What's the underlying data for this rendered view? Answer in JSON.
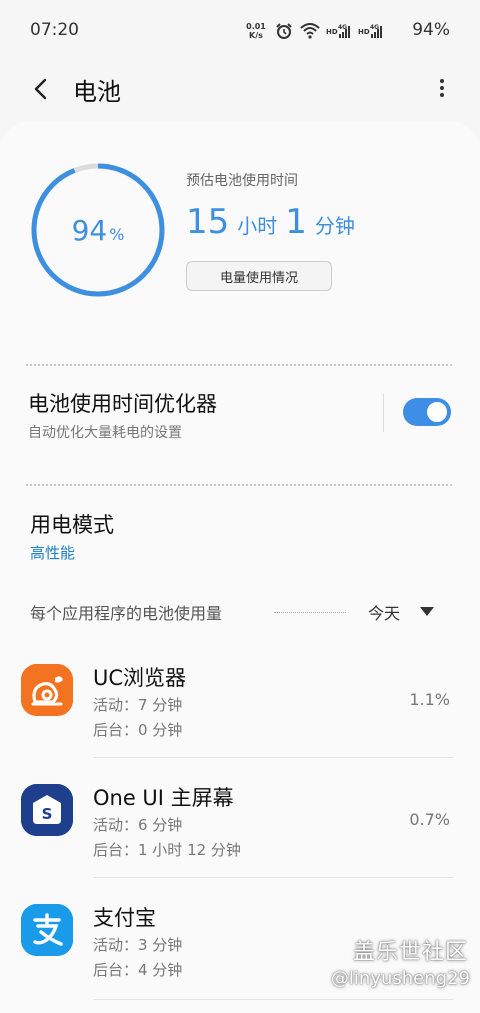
{
  "status": {
    "time": "07:20",
    "net_speed_top": "0.01",
    "net_speed_bottom": "K/s",
    "battery_pct": "94%",
    "icons": [
      "alarm-icon",
      "wifi-icon",
      "hd-icon",
      "signal-4g-icon",
      "hd-icon",
      "signal-4g-icon",
      "battery-icon"
    ]
  },
  "appbar": {
    "title": "电池"
  },
  "battery": {
    "level_num": "94",
    "level_unit": "%",
    "level_fraction": 0.94,
    "est_label": "预估电池使用时间",
    "est_hours": "15",
    "est_hours_unit": "小时",
    "est_minutes": "1",
    "est_minutes_unit": "分钟",
    "usage_button": "电量使用情况",
    "accent_color": "#3d8fe0"
  },
  "optimizer": {
    "title": "电池使用时间优化器",
    "subtitle": "自动优化大量耗电的设置",
    "enabled": true
  },
  "power_mode": {
    "title": "用电模式",
    "value": "高性能"
  },
  "per_app": {
    "header": "每个应用程序的电池使用量",
    "period": "今天",
    "apps": [
      {
        "name": "UC浏览器",
        "active": "活动：7 分钟",
        "background": "后台：0 分钟",
        "percent": "1.1%",
        "icon": "uc-browser-icon"
      },
      {
        "name": "One UI 主屏幕",
        "active": "活动：6 分钟",
        "background": "后台：1 小时 12 分钟",
        "percent": "0.7%",
        "icon": "one-ui-home-icon"
      },
      {
        "name": "支付宝",
        "active": "活动：3 分钟",
        "background": "后台：4 分钟",
        "percent": "",
        "icon": "alipay-icon"
      }
    ]
  },
  "watermark": {
    "line1": "盖乐世社区",
    "line2": "@linyusheng29"
  }
}
